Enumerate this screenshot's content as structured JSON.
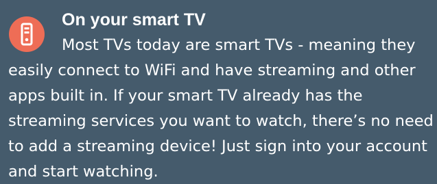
{
  "colors": {
    "background": "#455b6c",
    "icon_badge": "#ee6d56",
    "text": "#ffffff"
  },
  "icon": "streaming-device-icon",
  "section": {
    "title": "On your smart TV",
    "body": "Most TVs today are smart TVs - meaning they easily connect to WiFi and have streaming and other apps built in. If your smart TV already has the streaming services you want to watch, there’s no need to add a streaming device! Just sign into your account and start watching."
  }
}
